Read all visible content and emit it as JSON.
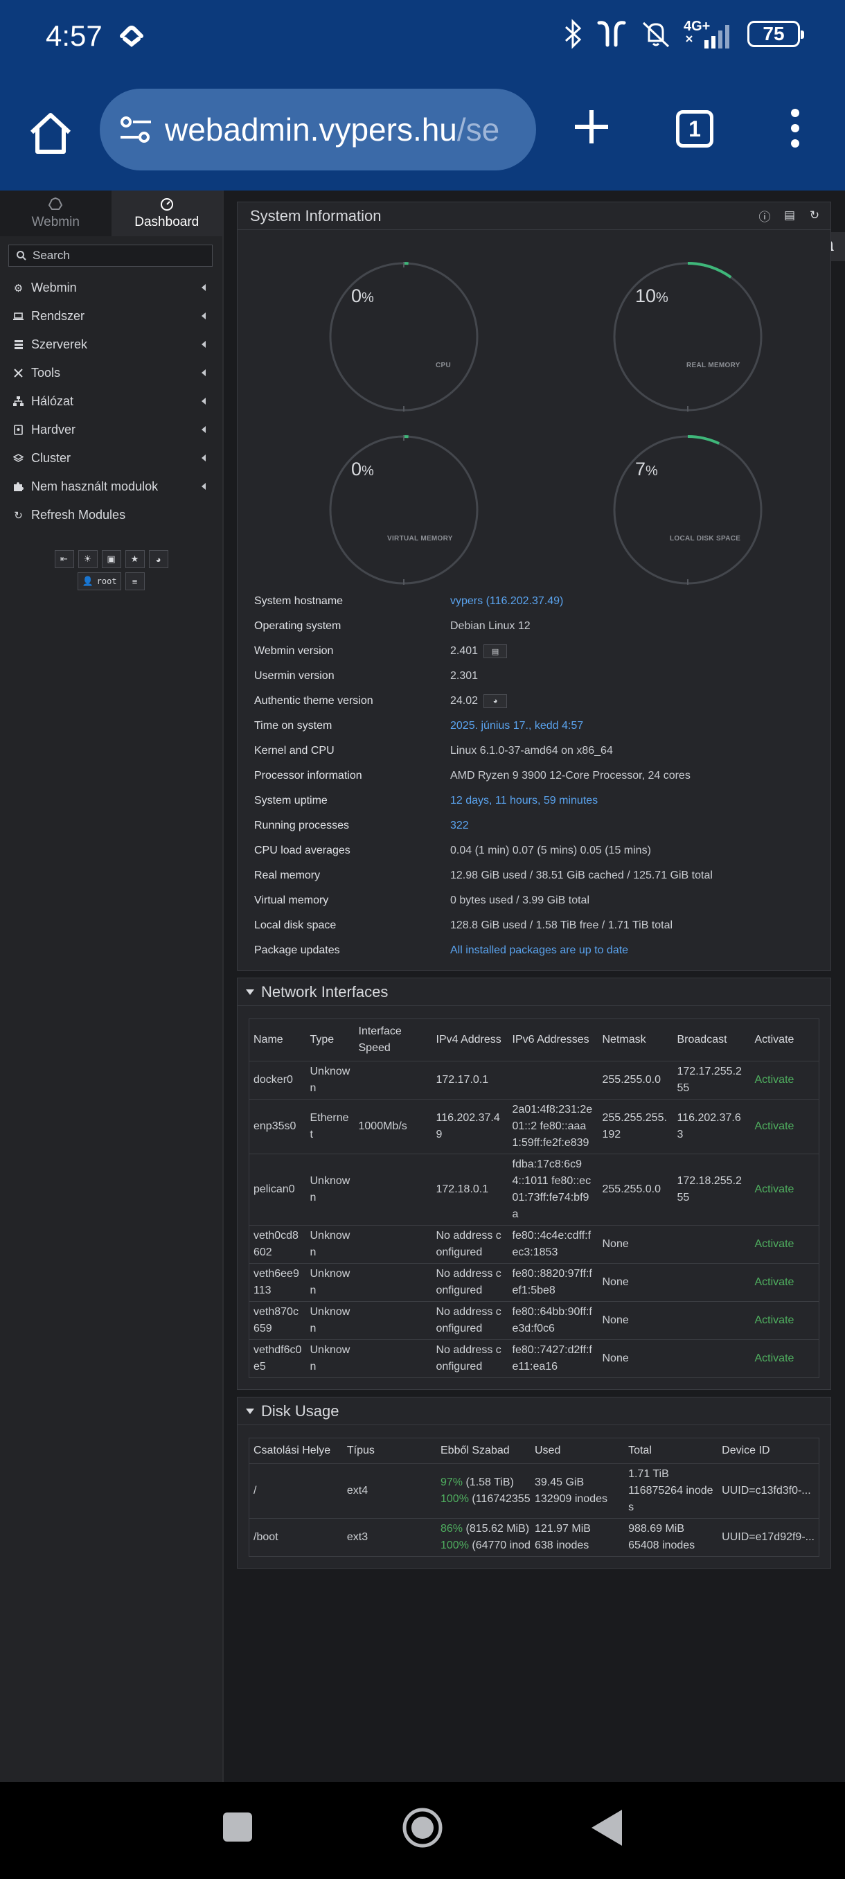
{
  "status_bar": {
    "time": "4:57",
    "battery": "75",
    "network": "4G+"
  },
  "browser": {
    "url_main": "webadmin.vypers.hu",
    "url_dim": "/se",
    "tab_count": "1"
  },
  "sidebar": {
    "tabs": [
      {
        "label": "Webmin"
      },
      {
        "label": "Dashboard"
      }
    ],
    "search_placeholder": "Search",
    "items": [
      {
        "label": "Webmin"
      },
      {
        "label": "Rendszer"
      },
      {
        "label": "Szerverek"
      },
      {
        "label": "Tools"
      },
      {
        "label": "Hálózat"
      },
      {
        "label": "Hardver"
      },
      {
        "label": "Cluster"
      },
      {
        "label": "Nem használt modulok"
      },
      {
        "label": "Refresh Modules"
      }
    ],
    "user": "root"
  },
  "system_info": {
    "title": "System Information",
    "gauges": [
      {
        "label": "CPU",
        "value": "0",
        "unit": "%",
        "fraction": 0.0
      },
      {
        "label": "REAL MEMORY",
        "value": "10",
        "unit": "%",
        "fraction": 0.1
      },
      {
        "label": "VIRTUAL MEMORY",
        "value": "0",
        "unit": "%",
        "fraction": 0.0
      },
      {
        "label": "LOCAL DISK SPACE",
        "value": "7",
        "unit": "%",
        "fraction": 0.07
      }
    ],
    "rows": [
      {
        "key": "System hostname",
        "value": "vypers (116.202.37.49)",
        "link": true
      },
      {
        "key": "Operating system",
        "value": "Debian Linux 12",
        "link": false
      },
      {
        "key": "Webmin version",
        "value": "2.401",
        "link": false
      },
      {
        "key": "Usermin version",
        "value": "2.301",
        "link": false
      },
      {
        "key": "Authentic theme version",
        "value": "24.02",
        "link": false
      },
      {
        "key": "Time on system",
        "value": "2025. június 17., kedd 4:57",
        "link": true
      },
      {
        "key": "Kernel and CPU",
        "value": "Linux 6.1.0-37-amd64 on x86_64",
        "link": false
      },
      {
        "key": "Processor information",
        "value": "AMD Ryzen 9 3900 12-Core Processor, 24 cores",
        "link": false
      },
      {
        "key": "System uptime",
        "value": "12 days, 11 hours, 59 minutes",
        "link": true
      },
      {
        "key": "Running processes",
        "value": "322",
        "link": true
      },
      {
        "key": "CPU load averages",
        "value": "0.04 (1 min) 0.07 (5 mins) 0.05 (15 mins)",
        "link": false
      },
      {
        "key": "Real memory",
        "value": "12.98 GiB used / 38.51 GiB cached / 125.71 GiB total",
        "link": false
      },
      {
        "key": "Virtual memory",
        "value": "0 bytes used / 3.99 GiB total",
        "link": false
      },
      {
        "key": "Local disk space",
        "value": "128.8 GiB used / 1.58 TiB free / 1.71 TiB total",
        "link": false
      },
      {
        "key": "Package updates",
        "value": "All installed packages are up to date",
        "link": true
      }
    ]
  },
  "network": {
    "title": "Network Interfaces",
    "columns": [
      "Name",
      "Type",
      "Interface Speed",
      "IPv4 Address",
      "IPv6 Addresses",
      "Netmask",
      "Broadcast",
      "Activate"
    ],
    "rows": [
      [
        "docker0",
        "Unknown",
        "",
        "172.17.0.1",
        "",
        "255.255.0.0",
        "172.17.255.255",
        "Activate"
      ],
      [
        "enp35s0",
        "Ethernet",
        "1000Mb/s",
        "116.202.37.49",
        "2a01:4f8:231:2e01::2 fe80::aaa1:59ff:fe2f:e839",
        "255.255.255.192",
        "116.202.37.63",
        "Activate"
      ],
      [
        "pelican0",
        "Unknown",
        "",
        "172.18.0.1",
        "fdba:17c8:6c94::1011 fe80::ec01:73ff:fe74:bf9a",
        "255.255.0.0",
        "172.18.255.255",
        "Activate"
      ],
      [
        "veth0cd8602",
        "Unknown",
        "",
        "No address configured",
        "fe80::4c4e:cdff:fec3:1853",
        "None",
        "",
        "Activate"
      ],
      [
        "veth6ee9113",
        "Unknown",
        "",
        "No address configured",
        "fe80::8820:97ff:fef1:5be8",
        "None",
        "",
        "Activate"
      ],
      [
        "veth870c659",
        "Unknown",
        "",
        "No address configured",
        "fe80::64bb:90ff:fe3d:f0c6",
        "None",
        "",
        "Activate"
      ],
      [
        "vethdf6c0e5",
        "Unknown",
        "",
        "No address configured",
        "fe80::7427:d2ff:fe11:ea16",
        "None",
        "",
        "Activate"
      ]
    ]
  },
  "disk": {
    "title": "Disk Usage",
    "columns": [
      "Csatolási Helye",
      "Típus",
      "Ebből Szabad",
      "Used",
      "Total",
      "Device ID"
    ],
    "rows": [
      {
        "mount": "/",
        "type": "ext4",
        "free_pct": "97%",
        "free": "(1.58 TiB)",
        "inode_pct": "100%",
        "inode_free": "(116742355",
        "used": "39.45 GiB",
        "used_inodes": "132909 inodes",
        "total": "1.71 TiB",
        "total_inodes": "116875264 inodes",
        "device": "UUID=c13fd3f0-..."
      },
      {
        "mount": "/boot",
        "type": "ext3",
        "free_pct": "86%",
        "free": "(815.62 MiB)",
        "inode_pct": "100%",
        "inode_free": "(64770 inod",
        "used": "121.97 MiB",
        "used_inodes": "638 inodes",
        "total": "988.69 MiB",
        "total_inodes": "65408 inodes",
        "device": "UUID=e17d92f9-..."
      }
    ]
  },
  "colors": {
    "gauge_fill": "#3fb77a",
    "link": "#5aa3ee",
    "activate": "#4fae5f",
    "status_bar": "#0c3a7c"
  }
}
